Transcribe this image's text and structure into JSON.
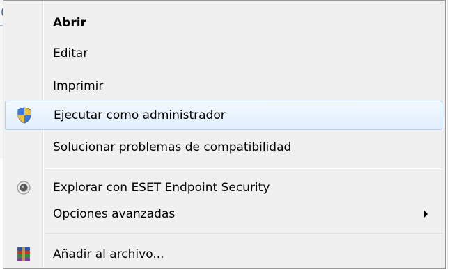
{
  "menu": {
    "items": [
      {
        "label": "Abrir",
        "bold": true
      },
      {
        "label": "Editar"
      },
      {
        "label": "Imprimir"
      },
      {
        "label": "Ejecutar como administrador",
        "icon": "uac-shield-icon",
        "highlighted": true
      },
      {
        "label": "Solucionar problemas de compatibilidad"
      },
      {
        "label": "Explorar con ESET Endpoint Security",
        "icon": "eset-icon"
      },
      {
        "label": "Opciones avanzadas",
        "submenu": true,
        "icon": "submenu-arrow-icon"
      },
      {
        "label": "Añadir al archivo...",
        "icon": "winrar-icon"
      }
    ]
  },
  "background": {
    "glyph": "("
  },
  "colors": {
    "highlight_border": "#aecff7",
    "highlight_fill": "#e1effd",
    "menu_bg": "#f0f0f0",
    "menu_border": "#979797"
  }
}
